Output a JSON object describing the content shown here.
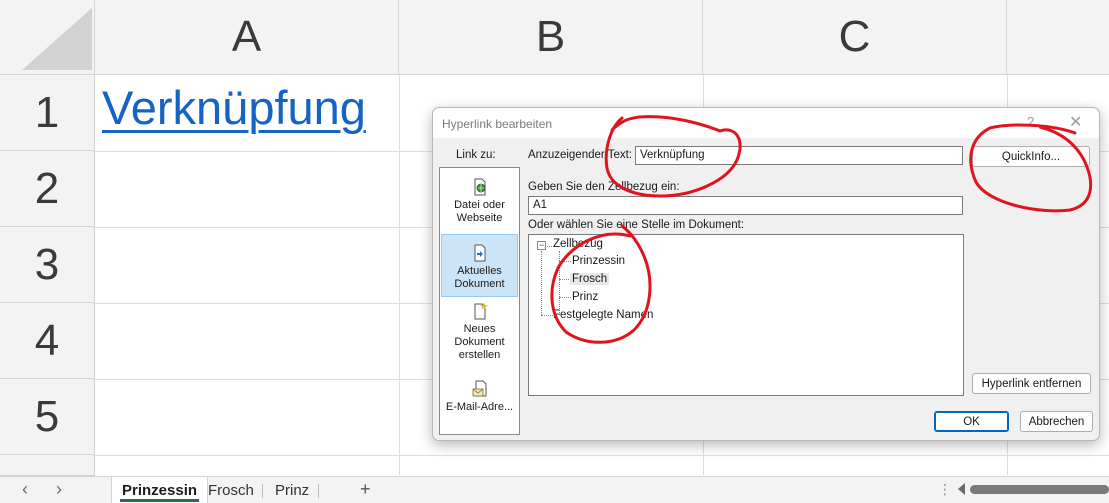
{
  "sheet": {
    "columns": [
      "A",
      "B",
      "C"
    ],
    "rows": [
      "1",
      "2",
      "3",
      "4",
      "5"
    ],
    "cell_a1": "Verknüpfung"
  },
  "tabs": {
    "prev_icon": "chevron-left-icon",
    "next_icon": "chevron-right-icon",
    "items": [
      "Prinzessin",
      "Frosch",
      "Prinz"
    ],
    "active": "Prinzessin",
    "add": "+",
    "more": "⋮"
  },
  "dialog": {
    "title": "Hyperlink bearbeiten",
    "help": "?",
    "close": "✕",
    "link_to_label": "Link zu:",
    "left_panel": [
      {
        "label_l1": "Datei oder",
        "label_l2": "Webseite",
        "icon": "globe-file-icon"
      },
      {
        "label_l1": "Aktuelles",
        "label_l2": "Dokument",
        "icon": "document-icon",
        "selected": true
      },
      {
        "label_l1": "Neues",
        "label_l2": "Dokument",
        "label_l3": "erstellen",
        "icon": "new-document-icon"
      },
      {
        "label_l1": "E-Mail-Adre...",
        "icon": "email-icon"
      }
    ],
    "display_text_label": "Anzuzeigender Text:",
    "display_text_value": "Verknüpfung",
    "quickinfo_button": "QuickInfo...",
    "cellref_label": "Geben Sie den Zellbezug ein:",
    "cellref_value": "A1",
    "place_label": "Oder wählen Sie eine Stelle im Dokument:",
    "tree": {
      "root": "Zellbezug",
      "children": [
        "Prinzessin",
        "Frosch",
        "Prinz"
      ],
      "selected_child": "Frosch",
      "root2": "Festgelegte Namen"
    },
    "remove_link_button": "Hyperlink entfernen",
    "ok_button": "OK",
    "cancel_button": "Abbrechen"
  },
  "colors": {
    "hyperlink": "#1563c4",
    "annotation": "#e0141e",
    "selection": "#cce4f7",
    "active_tab_underline": "#217346"
  }
}
